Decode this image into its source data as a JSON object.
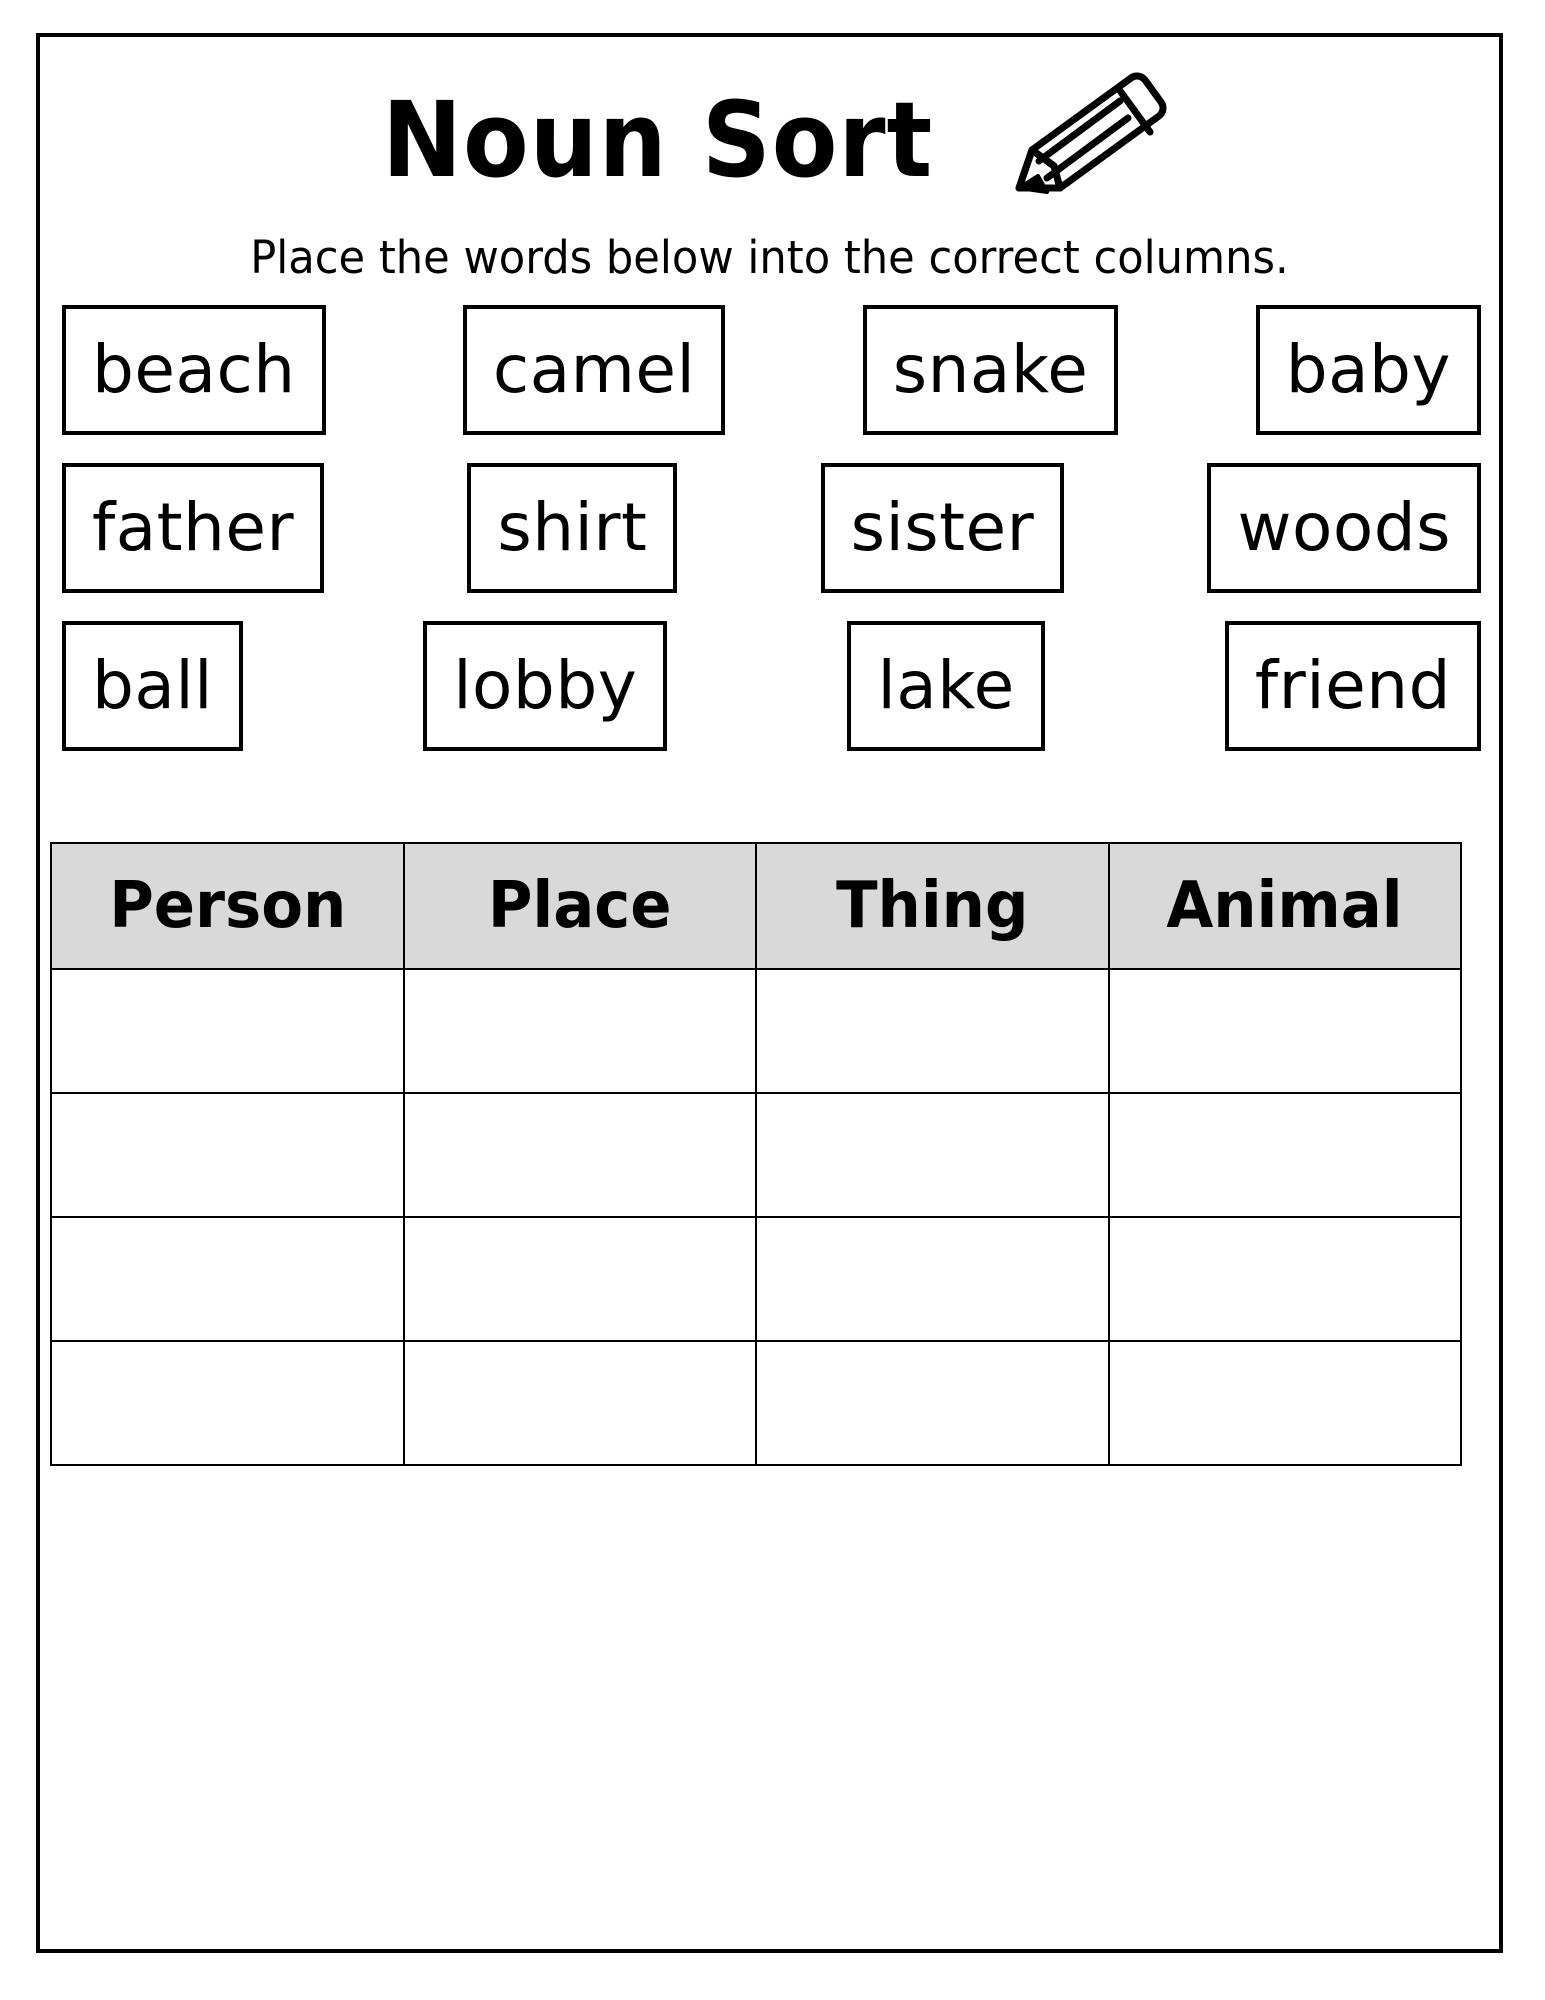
{
  "page": {
    "title": "Noun Sort",
    "subtitle": "Place the words below into the correct columns.",
    "title_icon": "pencil-icon",
    "border_color": "#000000",
    "background_color": "#ffffff"
  },
  "word_bank": {
    "rows": [
      [
        {
          "word": "beach"
        },
        {
          "word": "camel"
        },
        {
          "word": "snake"
        },
        {
          "word": "baby"
        }
      ],
      [
        {
          "word": "father"
        },
        {
          "word": "shirt"
        },
        {
          "word": "sister"
        },
        {
          "word": "woods"
        }
      ],
      [
        {
          "word": "ball"
        },
        {
          "word": "lobby"
        },
        {
          "word": "lake"
        },
        {
          "word": "friend"
        }
      ]
    ]
  },
  "sort_table": {
    "header_background": "#d9d9d9",
    "columns": [
      {
        "label": "Person"
      },
      {
        "label": "Place"
      },
      {
        "label": "Thing"
      },
      {
        "label": "Animal"
      }
    ],
    "rows": [
      [
        "",
        "",
        "",
        ""
      ],
      [
        "",
        "",
        "",
        ""
      ],
      [
        "",
        "",
        "",
        ""
      ],
      [
        "",
        "",
        "",
        ""
      ]
    ]
  }
}
